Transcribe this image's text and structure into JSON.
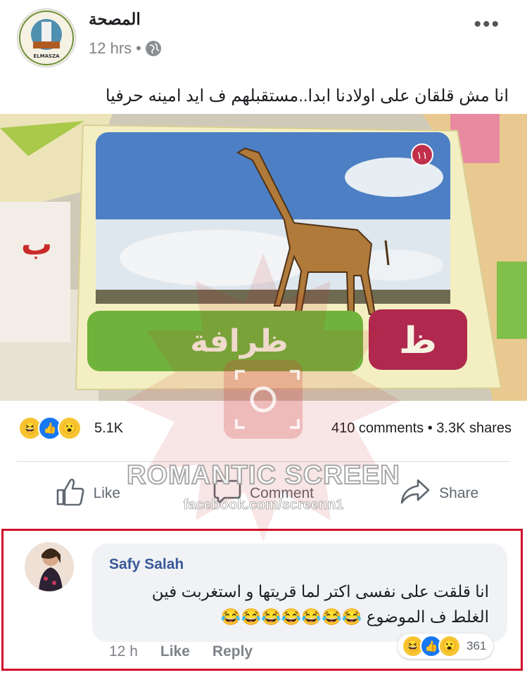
{
  "post": {
    "page_name": "المصحة",
    "page_logo_text": "ELMASZA",
    "time": "12 hrs",
    "separator": "•",
    "more": "•••",
    "text": "انا مش قلقان على اولادنا ابدا..مستقبلهم ف ايد امينه حرفيا"
  },
  "photo": {
    "card_word": "ظرافة",
    "card_letter": "ظ",
    "card_number": "١١"
  },
  "stats": {
    "reactions": [
      "haha",
      "like",
      "wow"
    ],
    "reaction_count": "5.1K",
    "comments": "410 comments",
    "dot": "•",
    "shares": "3.3K shares"
  },
  "actions": {
    "like": "Like",
    "comment": "Comment",
    "share": "Share"
  },
  "watermark": {
    "title": "ROMANTIC SCREEN",
    "url": "facebook.com/screenn1"
  },
  "comment": {
    "author": "Safy Salah",
    "text_line1": "انا قلقت على نفسى اكتر لما قريتها و استغربت فين",
    "text_line2": "الغلط ف الموضوع 😂😂😂😂😂😂😂",
    "time": "12 h",
    "like": "Like",
    "reply": "Reply",
    "reactions": [
      "haha",
      "like",
      "wow"
    ],
    "reaction_count": "361"
  },
  "colors": {
    "name_blue": "#385898",
    "like_blue": "#1877f2",
    "highlight_red": "#d0102a",
    "card_green": "#6fb33c",
    "card_red": "#b0284e"
  }
}
